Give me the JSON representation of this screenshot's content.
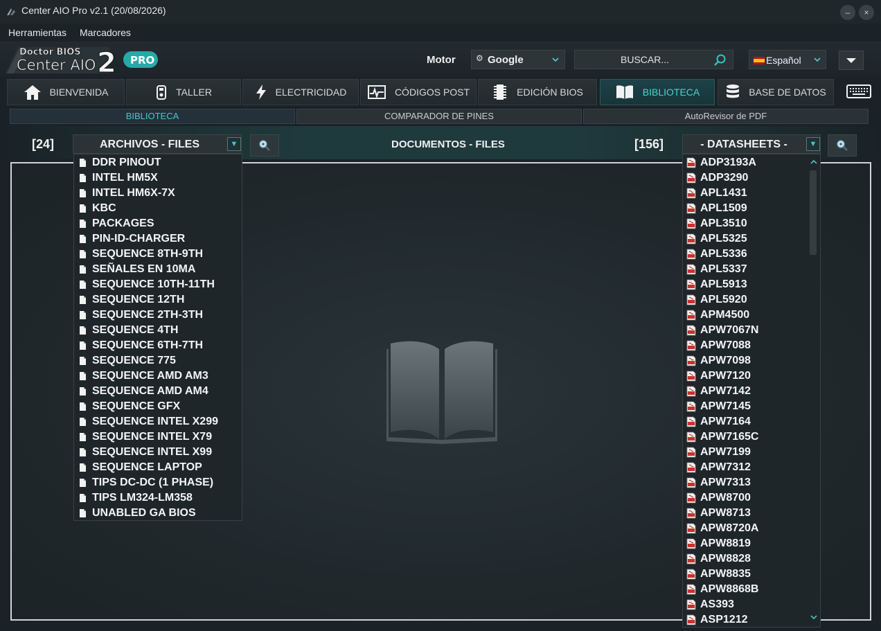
{
  "window": {
    "title": "Center AIO Pro v2.1 (20/08/2026)",
    "minimize_label": "–",
    "close_label": "×"
  },
  "menubar": {
    "items": [
      "Herramientas",
      "Marcadores"
    ]
  },
  "logo": {
    "line1": "Doctor BIOS",
    "line2": "Center AIO",
    "number": "2",
    "badge": "PRO"
  },
  "header": {
    "motor_label": "Motor",
    "motor_value": "Google",
    "search_placeholder": "BUSCAR...",
    "language": "Español"
  },
  "tabs": [
    {
      "label": "BIENVENIDA",
      "icon": "home-icon"
    },
    {
      "label": "TALLER",
      "icon": "multimeter-icon"
    },
    {
      "label": "ELECTRICIDAD",
      "icon": "lightning-icon"
    },
    {
      "label": "CÓDIGOS POST",
      "icon": "post-card-icon"
    },
    {
      "label": "EDICIÓN BIOS",
      "icon": "chip-icon"
    },
    {
      "label": "BIBLIOTECA",
      "icon": "book-icon",
      "active": true
    },
    {
      "label": "BASE DE DATOS",
      "icon": "database-icon"
    }
  ],
  "subtabs": [
    {
      "label": "BIBLIOTECA",
      "active": true
    },
    {
      "label": "COMPARADOR DE PINES"
    },
    {
      "label": "AutoRevisor de PDF"
    }
  ],
  "toolbar": {
    "left_count": "[24]",
    "left_dropdown": "ARCHIVOS - FILES",
    "center_label": "DOCUMENTOS - FILES",
    "right_count": "[156]",
    "right_dropdown": "- DATASHEETS -"
  },
  "files_list": [
    "DDR PINOUT",
    "INTEL HM5X",
    "INTEL HM6X-7X",
    "KBC",
    "PACKAGES",
    "PIN-ID-CHARGER",
    "SEQUENCE 8TH-9TH",
    "SEÑALES EN 10MA",
    "SEQUENCE 10TH-11TH",
    "SEQUENCE 12TH",
    "SEQUENCE 2TH-3TH",
    "SEQUENCE 4TH",
    "SEQUENCE 6TH-7TH",
    "SEQUENCE 775",
    "SEQUENCE AMD AM3",
    "SEQUENCE AMD AM4",
    "SEQUENCE GFX",
    "SEQUENCE INTEL X299",
    "SEQUENCE INTEL X79",
    "SEQUENCE INTEL X99",
    "SEQUENCE LAPTOP",
    "TIPS DC-DC (1 PHASE)",
    "TIPS LM324-LM358",
    "UNABLED GA BIOS"
  ],
  "datasheets_list": [
    "ADP3193A",
    "ADP3290",
    "APL1431",
    "APL1509",
    "APL3510",
    "APL5325",
    "APL5336",
    "APL5337",
    "APL5913",
    "APL5920",
    "APM4500",
    "APW7067N",
    "APW7088",
    "APW7098",
    "APW7120",
    "APW7142",
    "APW7145",
    "APW7164",
    "APW7165C",
    "APW7199",
    "APW7312",
    "APW7313",
    "APW8700",
    "APW8713",
    "APW8720A",
    "APW8819",
    "APW8828",
    "APW8835",
    "APW8868B",
    "AS393",
    "ASP1212"
  ],
  "colors": {
    "accent": "#4fd1d1",
    "background": "#1b2227",
    "pdf_red": "#c8322c"
  }
}
